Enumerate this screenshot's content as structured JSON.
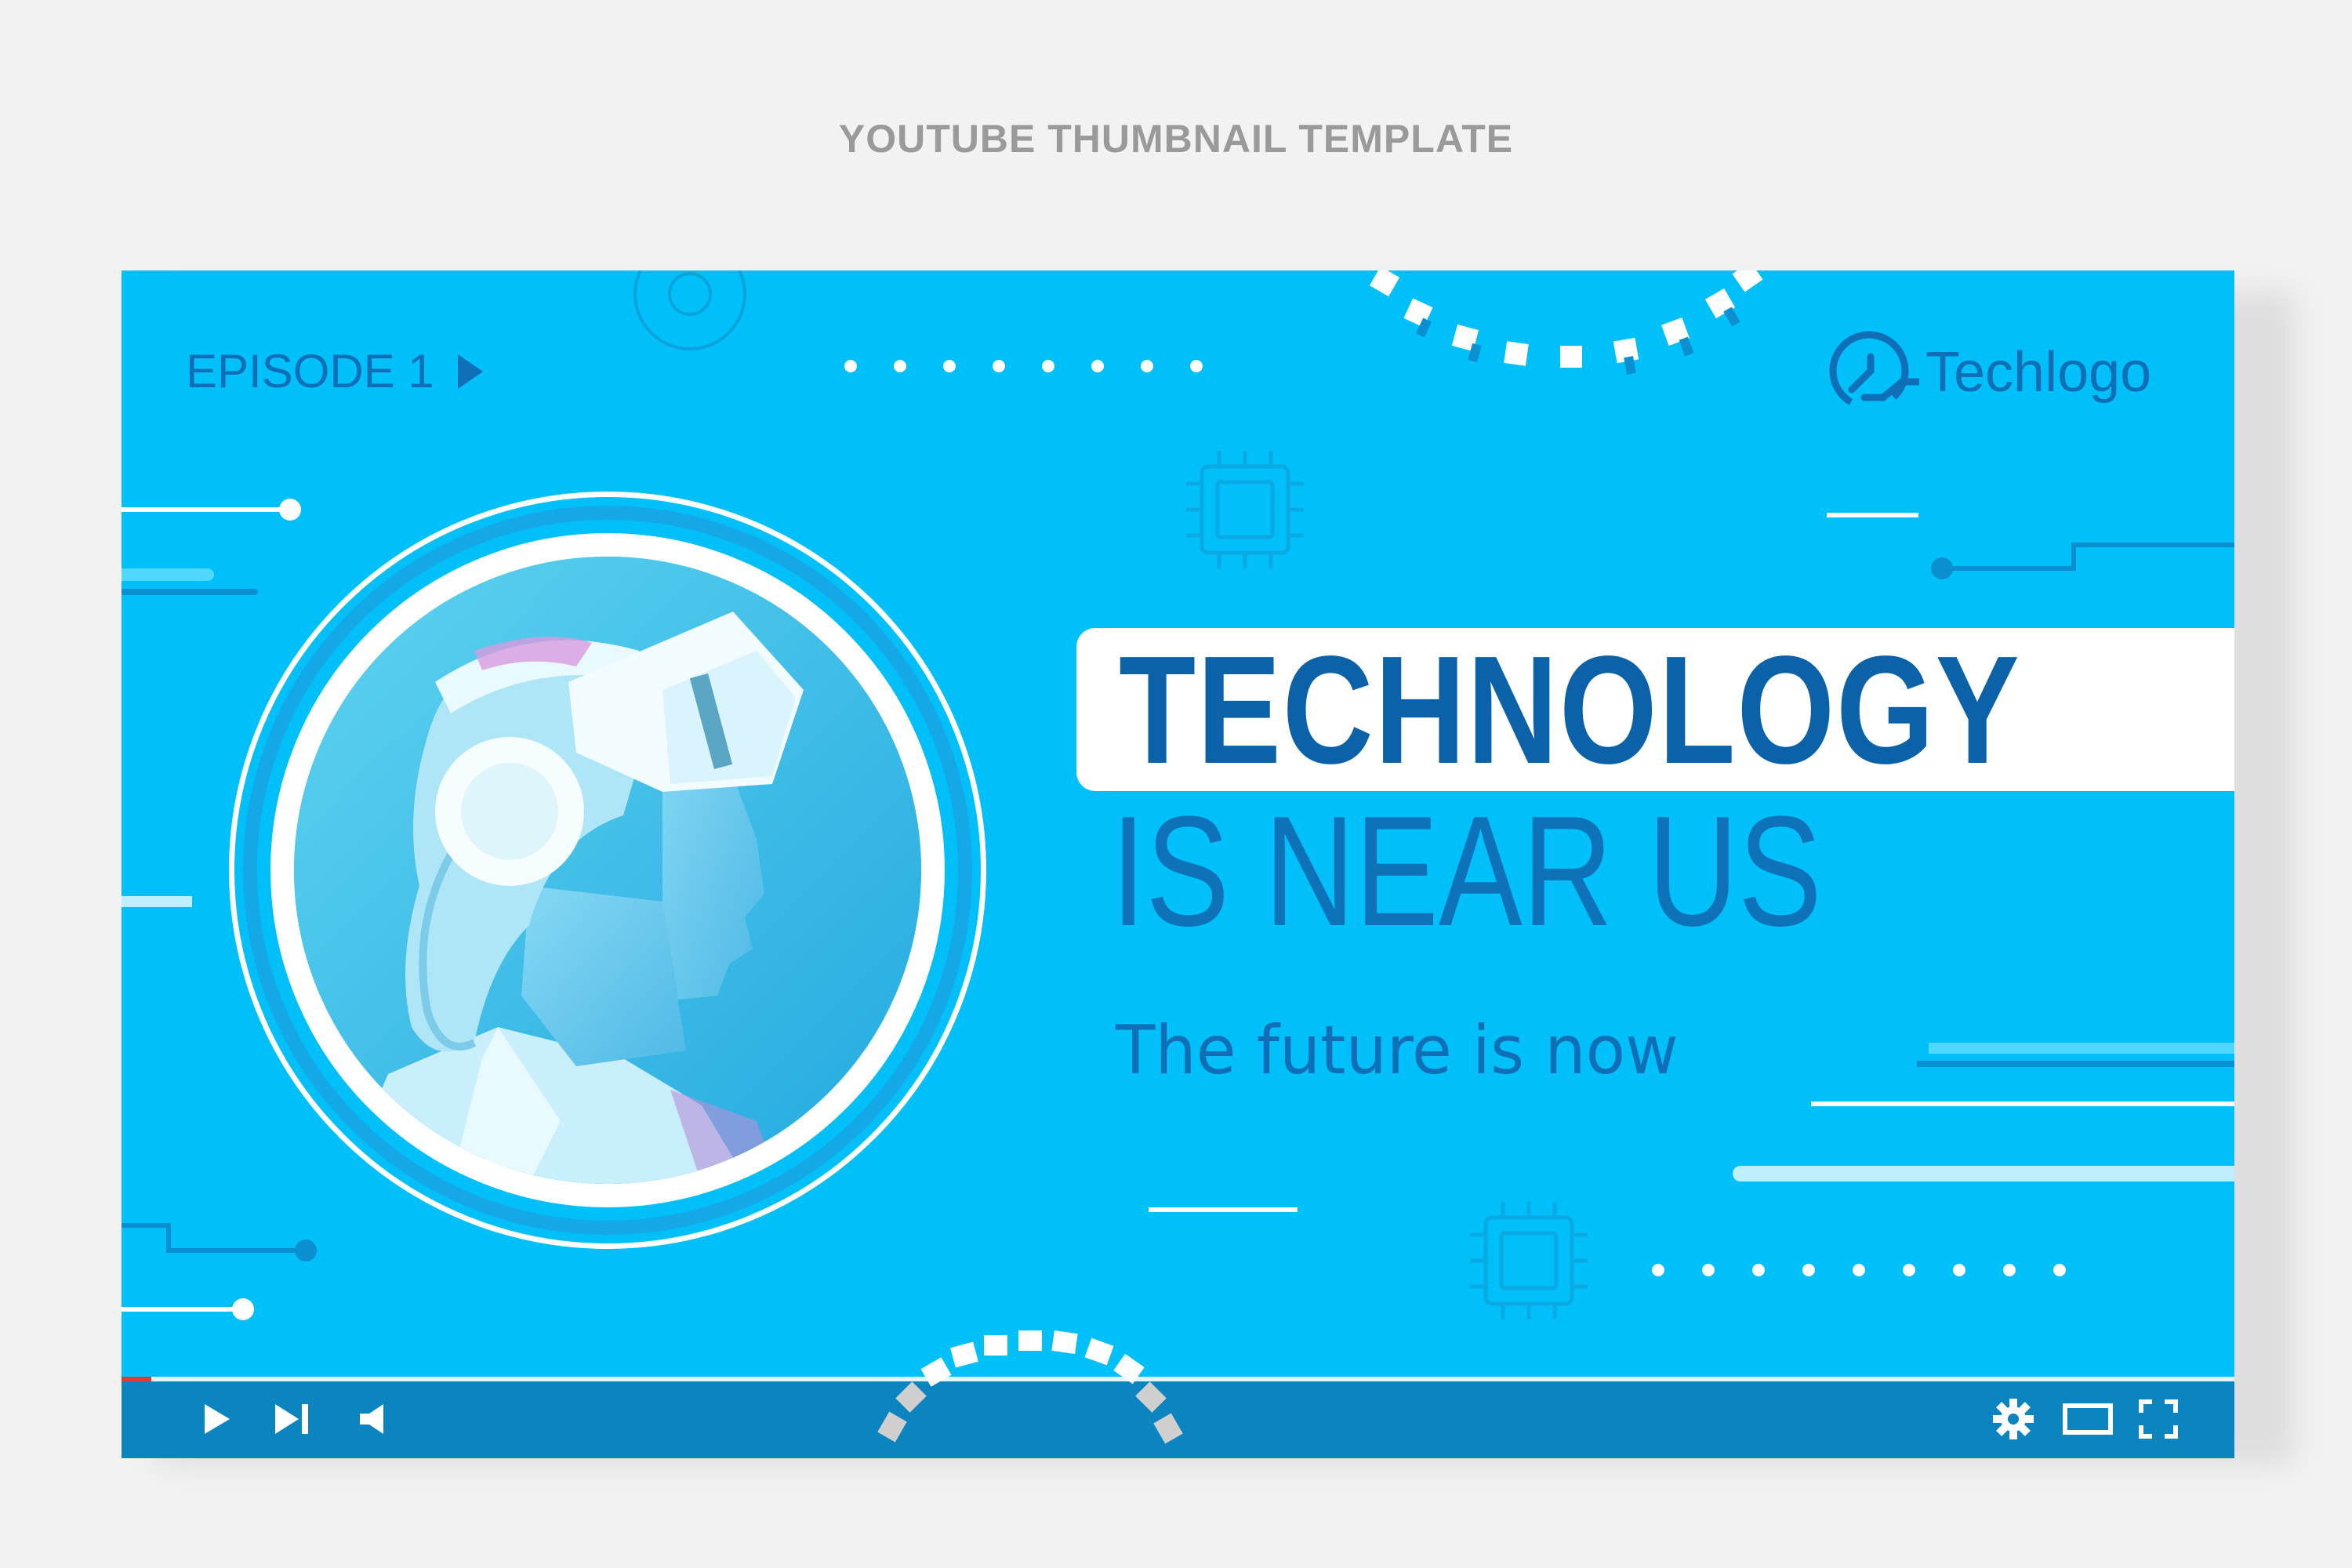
{
  "page": {
    "title": "YOUTUBE THUMBNAIL TEMPLATE"
  },
  "thumbnail": {
    "episode_label": "EPISODE 1",
    "logo_text": "Techlogo",
    "headline": "TECHNOLOGY",
    "subheadline": "IS NEAR US",
    "tagline": "The future is now"
  },
  "player": {
    "progress_fraction": 0.014,
    "controls": [
      "play-icon",
      "skip-next-icon",
      "volume-icon",
      "settings-icon",
      "theater-mode-icon",
      "fullscreen-icon"
    ]
  },
  "colors": {
    "background": "#00bff9",
    "text_blue": "#0f6fb6",
    "player_bar": "#0b84bf",
    "progress": "#e53935"
  }
}
